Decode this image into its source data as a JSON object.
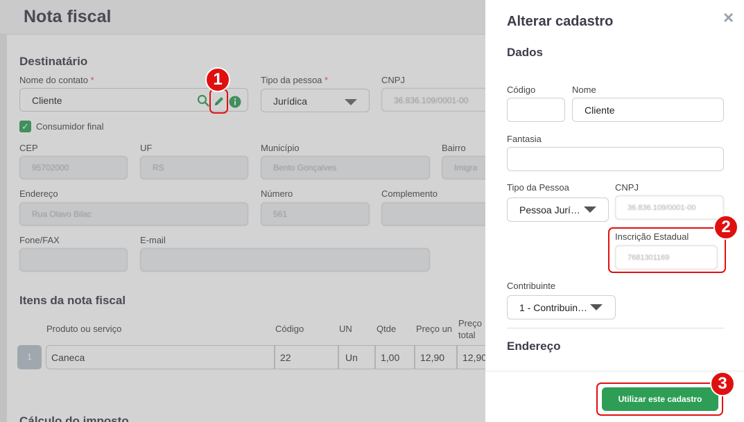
{
  "main": {
    "title": "Nota fiscal",
    "destinatario_title": "Destinatário",
    "nome_contato_label": "Nome do contato",
    "nome_contato_value": "Cliente",
    "required_mark": "*",
    "tipo_pessoa_label": "Tipo da pessoa",
    "tipo_pessoa_value": "Jurídica",
    "cnpj_label": "CNPJ",
    "cnpj_value": "36.836.109/0001-00",
    "consumidor_final_label": "Consumidor final",
    "cep_label": "CEP",
    "cep_value": "95702000",
    "uf_label": "UF",
    "uf_value": "RS",
    "municipio_label": "Município",
    "municipio_value": "Bento Gonçalves",
    "bairro_label": "Bairro",
    "bairro_value": "Imigra",
    "endereco_label": "Endereço",
    "endereco_value": "Rua Olavo Bilac",
    "numero_label": "Número",
    "numero_value": "561",
    "complemento_label": "Complemento",
    "fone_label": "Fone/FAX",
    "email_label": "E-mail",
    "itens_title": "Itens da nota fiscal",
    "table_headers": {
      "produto": "Produto ou serviço",
      "codigo": "Código",
      "un": "UN",
      "qtde": "Qtde",
      "preco_un": "Preço un",
      "preco_total_1": "Preço",
      "preco_total_2": "total"
    },
    "rows": [
      {
        "num": "1",
        "produto": "Caneca",
        "codigo": "22",
        "un": "Un",
        "qtde": "1,00",
        "preco_un": "12,90",
        "preco_total": "12,90"
      }
    ],
    "bottom_cut_title": "Cálculo do imposto"
  },
  "panel": {
    "title": "Alterar cadastro",
    "close_icon": "×",
    "dados_title": "Dados",
    "codigo_label": "Código",
    "codigo_value": "",
    "nome_label": "Nome",
    "nome_value": "Cliente",
    "fantasia_label": "Fantasia",
    "fantasia_value": "",
    "tipo_pessoa_label": "Tipo da Pessoa",
    "tipo_pessoa_value": "Pessoa Jurí…",
    "cnpj_label": "CNPJ",
    "cnpj_value": "36.836.109/0001-00",
    "inscricao_label": "Inscrição Estadual",
    "inscricao_value": "7681301169",
    "contribuinte_label": "Contribuinte",
    "contribuinte_value": "1 - Contribuin…",
    "endereco_title": "Endereço",
    "use_button": "Utilizar este cadastro"
  },
  "annotations": {
    "step1": "1",
    "step2": "2",
    "step3": "3"
  },
  "colors": {
    "accent_green": "#2e9e56",
    "highlight_red": "#e01010"
  },
  "icons": {
    "search": "search-icon",
    "edit": "pencil-icon",
    "info": "info-icon",
    "check": "check-icon",
    "caret": "caret-down-icon",
    "close": "close-icon"
  }
}
